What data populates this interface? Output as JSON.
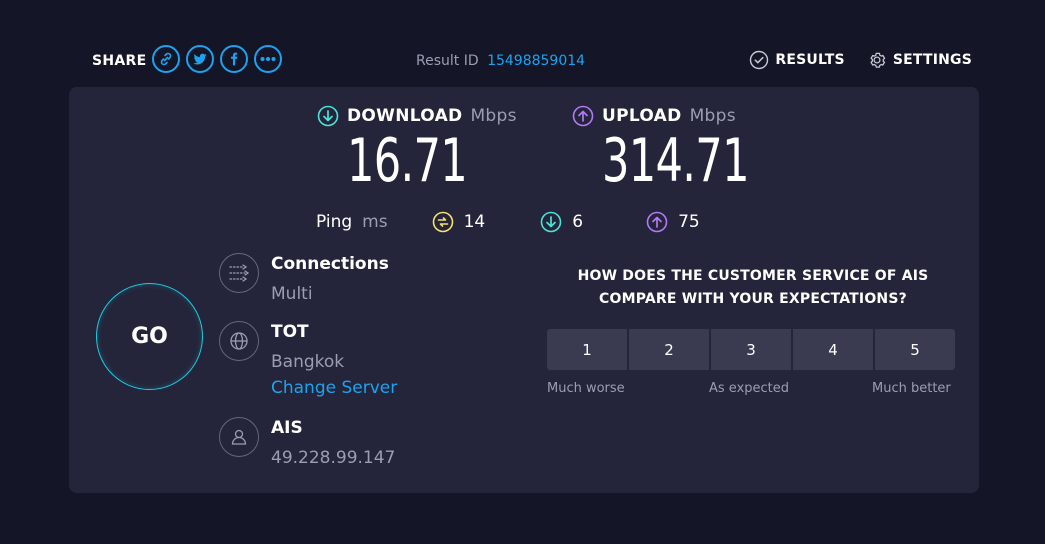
{
  "header": {
    "share_label": "SHARE",
    "share_icons": [
      "link-icon",
      "twitter-icon",
      "facebook-icon",
      "more-icon"
    ],
    "result_id_label": "Result ID",
    "result_id": "15498859014",
    "results_label": "RESULTS",
    "settings_label": "SETTINGS"
  },
  "download": {
    "label": "DOWNLOAD",
    "unit": "Mbps",
    "value": "16.71",
    "icon": "download-arrow-icon",
    "color": "#4fe3d8"
  },
  "upload": {
    "label": "UPLOAD",
    "unit": "Mbps",
    "value": "314.71",
    "icon": "upload-arrow-icon",
    "color": "#b479f5"
  },
  "ping": {
    "label": "Ping",
    "unit": "ms",
    "idle": "14",
    "download": "6",
    "upload": "75",
    "idle_color": "#f7e16b"
  },
  "go_label": "GO",
  "connections": {
    "title": "Connections",
    "value": "Multi"
  },
  "server": {
    "title": "TOT",
    "location": "Bangkok",
    "change_label": "Change Server"
  },
  "isp": {
    "title": "AIS",
    "ip": "49.228.99.147"
  },
  "survey": {
    "line1": "HOW DOES THE CUSTOMER SERVICE OF AIS",
    "line2": "COMPARE WITH YOUR EXPECTATIONS?",
    "options": [
      "1",
      "2",
      "3",
      "4",
      "5"
    ],
    "low_label": "Much worse",
    "mid_label": "As expected",
    "high_label": "Much better"
  },
  "colors": {
    "accent": "#1ca3f0",
    "background": "#141526",
    "panel": "#24253a"
  }
}
